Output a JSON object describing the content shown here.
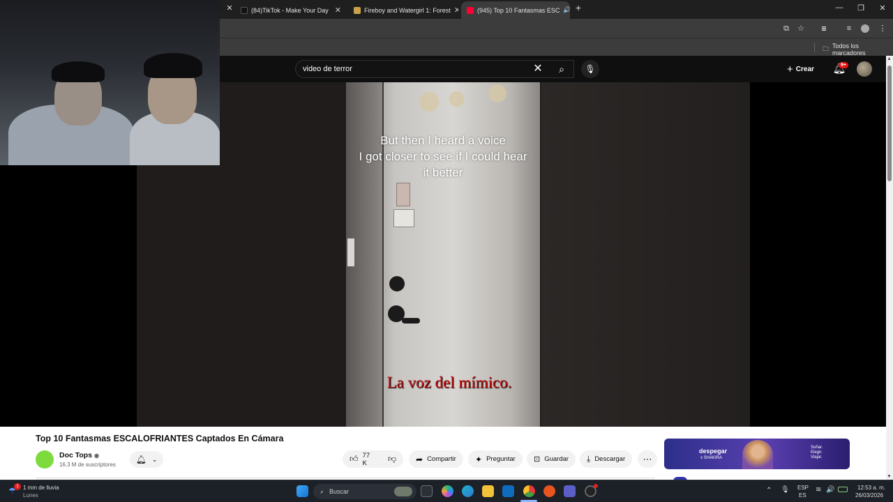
{
  "browser": {
    "tabs": [
      {
        "label": "(84)TikTok - Make Your Day",
        "favicon": "tiktok-icon"
      },
      {
        "label": "Fireboy and Watergirl 1: Forest",
        "favicon": "game-icon"
      },
      {
        "label": "(945) Top 10 Fantasmas ESC",
        "favicon": "youtube-icon",
        "active": true
      }
    ],
    "bookmarks_label": "Todos los marcadores"
  },
  "youtube": {
    "search_value": "video de terror",
    "create_label": "Crear",
    "notification_badge": "9+"
  },
  "video": {
    "caption_lines": [
      "But then I heard a voice",
      "I got closer to see if I could hear",
      "it better"
    ],
    "subtitle": "La voz del mímico.",
    "title": "Top 10 Fantasmas ESCALOFRIANTES Captados En Cámara",
    "channel_name": "Doc Tops",
    "channel_subs": "16.3 M de suscriptores",
    "likes": "77 K",
    "actions": {
      "share": "Compartir",
      "ask": "Preguntar",
      "save": "Guardar",
      "download": "Descargar"
    }
  },
  "ad": {
    "brand": "despegar",
    "brand_sub": "x SHAKIRA",
    "tagline_lines": [
      "Soñar.",
      "Elegir.",
      "Viajar."
    ]
  },
  "taskbar": {
    "weather_line1": "1 mm de lluvia",
    "weather_line2": "Lunes",
    "weather_badge": "1",
    "search_placeholder": "Buscar",
    "lang_line1": "ESP",
    "lang_line2": "ES",
    "time": "12:53 a. m.",
    "date": "26/03/2026"
  },
  "colors": {
    "subtitle_red": "#c40d0d",
    "yt_dark": "#0f0f0f",
    "badge_red": "#e21212",
    "channel_green": "#7ddb3e"
  }
}
